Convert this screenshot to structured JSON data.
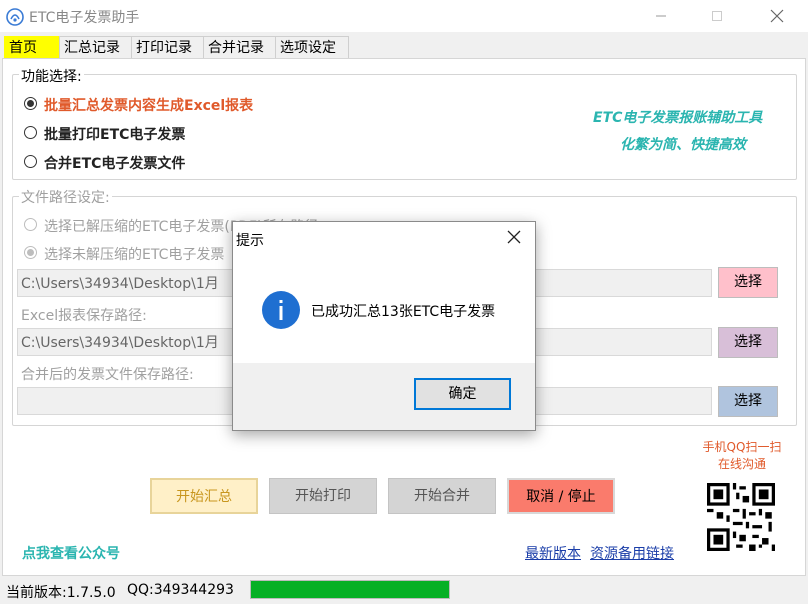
{
  "window": {
    "title": "ETC电子发票助手",
    "icon": "app-icon",
    "controls": [
      "minimize-icon",
      "maximize-icon",
      "close-icon"
    ]
  },
  "tabs": [
    {
      "label": "首页",
      "active": true
    },
    {
      "label": "汇总记录",
      "active": false
    },
    {
      "label": "打印记录",
      "active": false
    },
    {
      "label": "合并记录",
      "active": false
    },
    {
      "label": "选项设定",
      "active": false
    }
  ],
  "function_group": {
    "legend": "功能选择:",
    "options": [
      {
        "label": "批量汇总发票内容生成Excel报表",
        "checked": true,
        "color": "#e05a2b"
      },
      {
        "label": "批量打印ETC电子发票",
        "checked": false,
        "color": "#222222"
      },
      {
        "label": "合并ETC电子发票文件",
        "checked": false,
        "color": "#222222"
      }
    ],
    "slogan_line1": "ETC电子发票报账辅助工具",
    "slogan_line2": "化繁为简、快捷高效",
    "slogan_color": "#2bb5b0"
  },
  "path_group": {
    "legend": "文件路径设定:",
    "option_extracted": "选择已解压缩的ETC电子发票(PDF)所在路径",
    "option_compressed": "选择未解压缩的ETC电子发票",
    "source_path": "C:\\Users\\34934\\Desktop\\1月",
    "excel_label": "Excel报表保存路径:",
    "excel_path": "C:\\Users\\34934\\Desktop\\1月",
    "merge_label": "合并后的发票文件保存路径:",
    "merge_path": "",
    "select_label": "选择",
    "select_colors": [
      "#ffc0cb",
      "#d8bfd8",
      "#b0c4de"
    ]
  },
  "qr": {
    "line1": "手机QQ扫一扫",
    "line2": "在线沟通",
    "color": "#e05a2b"
  },
  "actions": {
    "start_summary": "开始汇总",
    "start_print": "开始打印",
    "start_merge": "开始合并",
    "cancel_stop": "取消 / 停止",
    "colors": {
      "summary": "#fff0c8",
      "disabled": "#d4d4d4",
      "cancel": "#fa7b6c"
    }
  },
  "links": {
    "public_account": "点我查看公众号",
    "latest_version": "最新版本",
    "backup_links": "资源备用链接"
  },
  "statusbar": {
    "version": "当前版本:1.7.5.0",
    "qq": "QQ:349344293",
    "progress": 1.0,
    "progress_color": "#06b025"
  },
  "dialog": {
    "title": "提示",
    "message": "已成功汇总13张ETC电子发票",
    "ok": "确定",
    "icon": "info-icon"
  }
}
